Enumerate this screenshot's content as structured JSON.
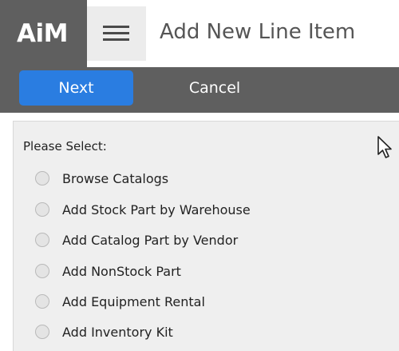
{
  "header": {
    "logo": "AiM",
    "title": "Add New Line Item",
    "menu_icon": "hamburger-menu-icon"
  },
  "toolbar": {
    "next_label": "Next",
    "cancel_label": "Cancel",
    "accent_color": "#2a7de1"
  },
  "panel": {
    "prompt": "Please Select:",
    "options": [
      {
        "label": "Browse Catalogs"
      },
      {
        "label": "Add Stock Part by Warehouse"
      },
      {
        "label": "Add Catalog Part by Vendor"
      },
      {
        "label": "Add NonStock Part"
      },
      {
        "label": "Add Equipment Rental"
      },
      {
        "label": "Add Inventory Kit"
      }
    ]
  }
}
